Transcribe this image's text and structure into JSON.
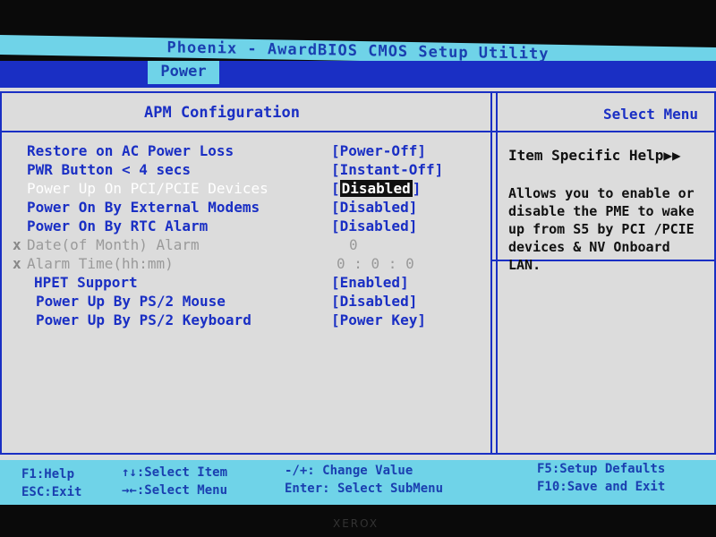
{
  "title": "Phoenix - AwardBIOS CMOS Setup Utility",
  "menu": {
    "active_tab": "Power"
  },
  "left_panel": {
    "header": "APM Configuration"
  },
  "right_panel": {
    "header": "Select Menu"
  },
  "settings": [
    {
      "marker": "",
      "label": "Restore on AC Power Loss",
      "value": "[Power-Off]",
      "state": "normal"
    },
    {
      "marker": "",
      "label": "PWR Button < 4 secs",
      "value": "[Instant-Off]",
      "state": "normal"
    },
    {
      "marker": "",
      "label": "Power Up On PCI/PCIE Devices",
      "value": "Disabled",
      "state": "highlight"
    },
    {
      "marker": "",
      "label": "Power On By External Modems",
      "value": "[Disabled]",
      "state": "normal"
    },
    {
      "marker": "",
      "label": "Power On By RTC Alarm",
      "value": "[Disabled]",
      "state": "normal"
    },
    {
      "marker": "x",
      "label": "Date(of Month) Alarm",
      "value": "0",
      "state": "disabled"
    },
    {
      "marker": "x",
      "label": "Alarm Time(hh:mm)",
      "value": "0 : 0 : 0",
      "state": "disabled"
    },
    {
      "marker": "",
      "label": "HPET Support",
      "value": "[Enabled]",
      "state": "normal"
    },
    {
      "marker": "",
      "label": "Power Up By PS/2 Mouse",
      "value": "[Disabled]",
      "state": "normal"
    },
    {
      "marker": "",
      "label": "Power Up By PS/2 Keyboard",
      "value": "[Power Key]",
      "state": "normal"
    }
  ],
  "help": {
    "title": "Item Specific Help▶▶",
    "text": "Allows you to enable or disable the PME to wake up from S5 by PCI /PCIE devices & NV Onboard LAN."
  },
  "status": {
    "f1": "F1:Help",
    "esc": "ESC:Exit",
    "select_item": "↑↓:Select Item",
    "select_menu": "→←:Select Menu",
    "change_value": "-/+: Change Value",
    "enter": "Enter: Select SubMenu",
    "f5": "F5:Setup Defaults",
    "f10": "F10:Save and Exit"
  },
  "bezel": {
    "brand": "XEROX"
  }
}
